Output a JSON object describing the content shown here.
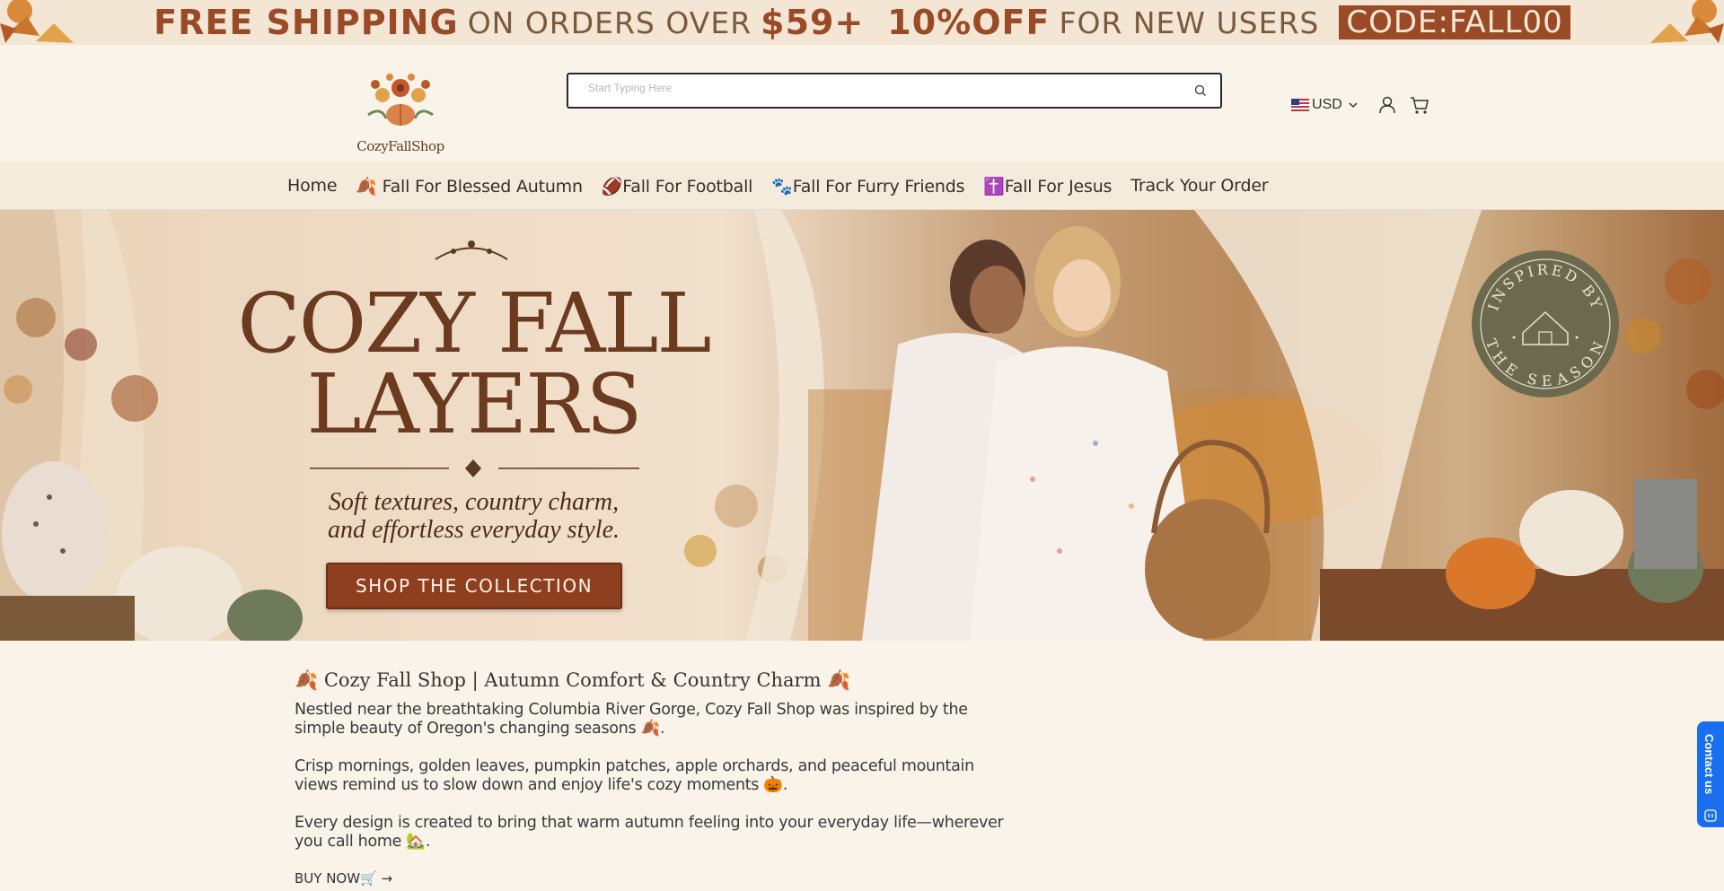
{
  "announcement": {
    "free_shipping": "FREE SHIPPING",
    "on_orders_over": "ON ORDERS OVER",
    "amount": "$59+",
    "discount": "10%OFF",
    "for_new_users": "FOR NEW USERS",
    "code": "CODE:FALL00"
  },
  "header": {
    "logo_text": "CozyFallShop",
    "search_placeholder": "Start Typing Here",
    "currency": "USD"
  },
  "nav": {
    "items": [
      {
        "label": "Home"
      },
      {
        "label": "🍂 Fall For Blessed Autumn"
      },
      {
        "label": "🏈Fall For Football"
      },
      {
        "label": "🐾Fall For Furry Friends"
      },
      {
        "label": "✝️Fall For Jesus"
      },
      {
        "label": "Track Your Order"
      }
    ]
  },
  "hero": {
    "title_line1": "COZY FALL",
    "title_line2": "LAYERS",
    "subtitle_line1": "Soft textures, country charm,",
    "subtitle_line2": "and effortless everyday style.",
    "button": "SHOP THE COLLECTION",
    "badge_top": "INSPIRED BY",
    "badge_bottom": "THE SEASON"
  },
  "content": {
    "heading": "🍂 Cozy Fall Shop | Autumn Comfort & Country Charm 🍂",
    "paragraphs": [
      "Nestled near the breathtaking Columbia River Gorge, Cozy Fall Shop was inspired by the simple beauty of Oregon's changing seasons 🍂.",
      "Crisp mornings, golden leaves, pumpkin patches, apple orchards, and peaceful mountain views remind us to slow down and enjoy life's cozy moments 🎃.",
      "Every design is created to bring that warm autumn feeling into your everyday life—wherever you call home 🏡."
    ],
    "buy_now": "BUY NOW🛒 →"
  },
  "contact": {
    "label": "Contact us"
  },
  "colors": {
    "accent": "#9a4a26",
    "contact_blue": "#1a6ff0",
    "page_bg": "#f9f3ea"
  }
}
